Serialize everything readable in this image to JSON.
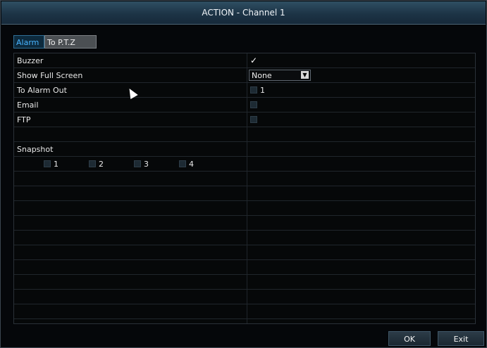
{
  "title": "ACTION - Channel 1",
  "tabs": [
    {
      "label": "Alarm",
      "active": true
    },
    {
      "label": "To P.T.Z",
      "active": false
    }
  ],
  "rows": {
    "buzzer": {
      "label": "Buzzer",
      "checked": true,
      "check_glyph": "✓"
    },
    "full_screen": {
      "label": "Show Full Screen",
      "value": "None",
      "arrow": "▼"
    },
    "alarm_out": {
      "label": "To Alarm Out",
      "option_label": "1"
    },
    "email": {
      "label": "Email"
    },
    "ftp": {
      "label": "FTP"
    }
  },
  "snapshot": {
    "label": "Snapshot",
    "channels": [
      "1",
      "2",
      "3",
      "4"
    ]
  },
  "buttons": {
    "ok": "OK",
    "exit": "Exit"
  },
  "colors": {
    "title_bar": "#1d3446",
    "active_tab_text": "#48b4ff",
    "inactive_tab_bg": "#4b4f53"
  }
}
